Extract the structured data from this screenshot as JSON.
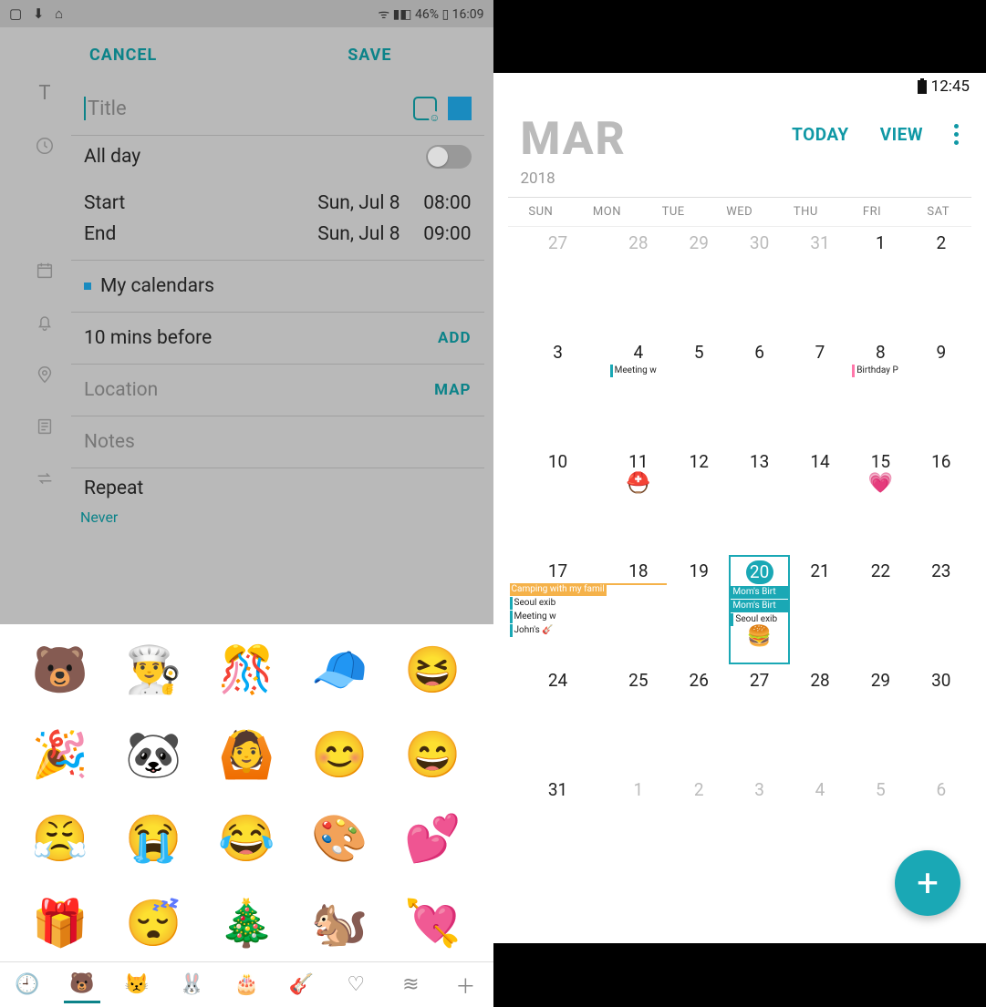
{
  "left": {
    "status": {
      "icons": "▢ ⬇ ⌂",
      "right": "ᯤ ▮◧ 46% ▯ 16:09"
    },
    "actions": {
      "cancel": "CANCEL",
      "save": "SAVE"
    },
    "title": {
      "placeholder": "Title"
    },
    "allday": {
      "label": "All day",
      "on": false
    },
    "start": {
      "label": "Start",
      "date": "Sun, Jul 8",
      "time": "08:00"
    },
    "end": {
      "label": "End",
      "date": "Sun, Jul 8",
      "time": "09:00"
    },
    "calendar": {
      "label": "My calendars"
    },
    "reminder": {
      "label": "10 mins before",
      "add": "ADD"
    },
    "location": {
      "label": "Location",
      "map": "MAP"
    },
    "notes": {
      "label": "Notes"
    },
    "repeat": {
      "label": "Repeat",
      "value": "Never"
    },
    "stickers": [
      "🐻",
      "👨‍🍳",
      "🎊",
      "🧢",
      "😆",
      "🎉",
      "🐼",
      "🙆",
      "😊",
      "😄",
      "😤",
      "😭",
      "😂",
      "🎨",
      "💕",
      "🎁",
      "😴",
      "🎄",
      "🐿️",
      "💘"
    ],
    "tabs": [
      "🕘",
      "🐻",
      "😾",
      "🐰",
      "🎂",
      "🎸",
      "♡",
      "≋",
      "＋"
    ]
  },
  "right": {
    "status": {
      "time": "12:45"
    },
    "header": {
      "month": "MAR",
      "year": "2018",
      "today": "TODAY",
      "view": "VIEW"
    },
    "dow": [
      "SUN",
      "MON",
      "TUE",
      "WED",
      "THU",
      "FRI",
      "SAT"
    ],
    "weeks": [
      [
        {
          "n": "27",
          "other": true
        },
        {
          "n": "28",
          "other": true
        },
        {
          "n": "29",
          "other": true
        },
        {
          "n": "30",
          "other": true
        },
        {
          "n": "31",
          "other": true
        },
        {
          "n": "1"
        },
        {
          "n": "2"
        }
      ],
      [
        {
          "n": "3"
        },
        {
          "n": "4",
          "events": [
            {
              "t": "Meeting w",
              "cls": "b-teal"
            }
          ]
        },
        {
          "n": "5"
        },
        {
          "n": "6"
        },
        {
          "n": "7"
        },
        {
          "n": "8",
          "events": [
            {
              "t": "Birthday P",
              "cls": "b-pink"
            }
          ]
        },
        {
          "n": "9"
        }
      ],
      [
        {
          "n": "10"
        },
        {
          "n": "11",
          "sticker": "⛑️"
        },
        {
          "n": "12"
        },
        {
          "n": "13"
        },
        {
          "n": "14"
        },
        {
          "n": "15",
          "sticker": "💗"
        },
        {
          "n": "16"
        }
      ],
      [
        {
          "n": "17",
          "events": [
            {
              "t": "Camping with my famil",
              "cls": "bg-orange"
            },
            {
              "t": "Seoul exib",
              "cls": "b-teal"
            },
            {
              "t": "Meeting w",
              "cls": "b-teal"
            },
            {
              "t": "John's 🎸",
              "cls": "b-teal"
            }
          ]
        },
        {
          "n": "18",
          "events": [
            {
              "t": " ",
              "cls": "bg-orange spanleft"
            }
          ]
        },
        {
          "n": "19"
        },
        {
          "n": "20",
          "sel": true,
          "events": [
            {
              "t": "Mom's Birt",
              "cls": "bg-teal"
            },
            {
              "t": "Mom's Birt",
              "cls": "bg-teal"
            },
            {
              "t": "Seoul exib",
              "cls": "b-teal"
            }
          ],
          "sticker": "🍔"
        },
        {
          "n": "21"
        },
        {
          "n": "22"
        },
        {
          "n": "23"
        }
      ],
      [
        {
          "n": "24"
        },
        {
          "n": "25"
        },
        {
          "n": "26"
        },
        {
          "n": "27"
        },
        {
          "n": "28"
        },
        {
          "n": "29"
        },
        {
          "n": "30"
        }
      ],
      [
        {
          "n": "31"
        },
        {
          "n": "1",
          "other": true
        },
        {
          "n": "2",
          "other": true
        },
        {
          "n": "3",
          "other": true
        },
        {
          "n": "4",
          "other": true
        },
        {
          "n": "5",
          "other": true
        },
        {
          "n": "6",
          "other": true
        }
      ]
    ],
    "fab": "+"
  }
}
